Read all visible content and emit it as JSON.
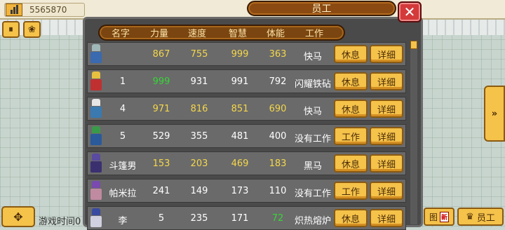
{
  "money": {
    "value": "5565870"
  },
  "panel": {
    "title": "员工"
  },
  "headers": [
    "名字",
    "力量",
    "速度",
    "智慧",
    "体能",
    "工作"
  ],
  "rows": [
    {
      "name": "",
      "str": "867",
      "spd": "755",
      "wis": "999",
      "sta": "363",
      "job": "快马",
      "action": "休息",
      "detail": "详细",
      "colors": [
        "#f5d74a",
        "#f5d74a",
        "#f5d74a",
        "#f5d74a"
      ],
      "hair": "#9fb7b7",
      "body": "#3a6ab0"
    },
    {
      "name": "1",
      "str": "999",
      "spd": "931",
      "wis": "991",
      "sta": "792",
      "job": "闪耀铁砧",
      "action": "休息",
      "detail": "详细",
      "colors": [
        "#37d637",
        "#ffffff",
        "#ffffff",
        "#ffffff"
      ],
      "hair": "#e8c040",
      "body": "#c03030"
    },
    {
      "name": "4",
      "str": "971",
      "spd": "816",
      "wis": "851",
      "sta": "690",
      "job": "快马",
      "action": "休息",
      "detail": "详细",
      "colors": [
        "#f5d74a",
        "#f5d74a",
        "#f5d74a",
        "#f5d74a"
      ],
      "hair": "#e6e6e6",
      "body": "#3a7ab0"
    },
    {
      "name": "5",
      "str": "529",
      "spd": "355",
      "wis": "481",
      "sta": "400",
      "job": "没有工作",
      "action": "工作",
      "detail": "详细",
      "colors": [
        "#ffffff",
        "#ffffff",
        "#ffffff",
        "#ffffff"
      ],
      "hair": "#3a9a4a",
      "body": "#2a5a9a"
    },
    {
      "name": "斗篷男",
      "str": "153",
      "spd": "203",
      "wis": "469",
      "sta": "183",
      "job": "黑马",
      "action": "休息",
      "detail": "详细",
      "colors": [
        "#f5d74a",
        "#f5d74a",
        "#f5d74a",
        "#f5d74a"
      ],
      "hair": "#5a4aa0",
      "body": "#3a3070"
    },
    {
      "name": "帕米拉",
      "str": "241",
      "spd": "149",
      "wis": "173",
      "sta": "110",
      "job": "没有工作",
      "action": "工作",
      "detail": "详细",
      "colors": [
        "#ffffff",
        "#ffffff",
        "#ffffff",
        "#ffffff"
      ],
      "hair": "#7a4ab0",
      "body": "#c08aa0"
    },
    {
      "name": "李",
      "str": "5",
      "spd": "235",
      "wis": "171",
      "sta": "72",
      "job": "炽热熔炉",
      "action": "休息",
      "detail": "详细",
      "colors": [
        "#ffffff",
        "#ffffff",
        "#ffffff",
        "#37d637"
      ],
      "hair": "#3a4aa0",
      "body": "#d0d0e0"
    }
  ],
  "bottom": {
    "game_time": "游戏时间0",
    "tujian": "图",
    "tujian_badge": "新",
    "staff": "员工"
  },
  "icons": {
    "money": "bar-chart-icon",
    "close": "close-icon",
    "pause": "pause-icon",
    "menu": "gear-icon",
    "forward": "fast-forward-icon",
    "move": "move-arrows-icon",
    "crown": "crown-icon"
  }
}
